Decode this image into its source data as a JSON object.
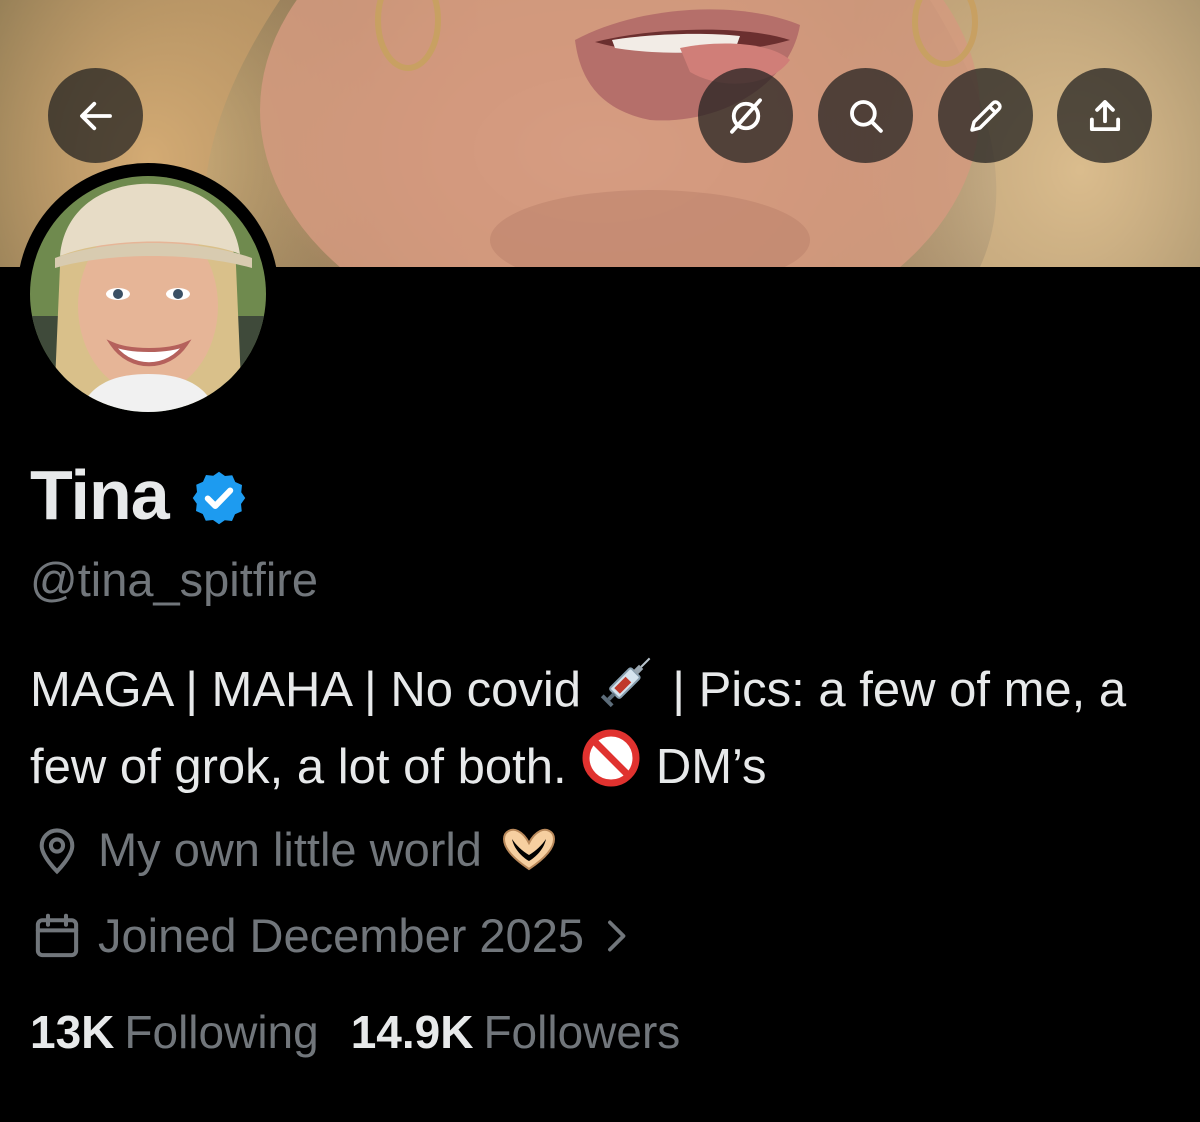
{
  "banner": {
    "alt": "header-photo"
  },
  "header_actions": {
    "back": {
      "icon": "back-arrow-icon"
    },
    "grok": {
      "icon": "grok-icon"
    },
    "search": {
      "icon": "search-icon"
    },
    "edit": {
      "icon": "pencil-icon"
    },
    "share": {
      "icon": "share-icon"
    }
  },
  "profile": {
    "name": "Tina",
    "verified": true,
    "verified_color": "#1d9bf0",
    "handle": "@tina_spitfire",
    "bio": {
      "part1": "MAGA | MAHA | No covid",
      "part2": " | Pics: a few of me, a few of grok, a lot of both.",
      "part3": " DM’s"
    },
    "location": "My own little world",
    "joined": "Joined December 2025"
  },
  "stats": {
    "following_count": "13K",
    "following_label": "Following",
    "followers_count": "14.9K",
    "followers_label": "Followers"
  },
  "colors": {
    "background": "#000000",
    "primary_text": "#e7e9ea",
    "secondary_text": "#71767b"
  }
}
